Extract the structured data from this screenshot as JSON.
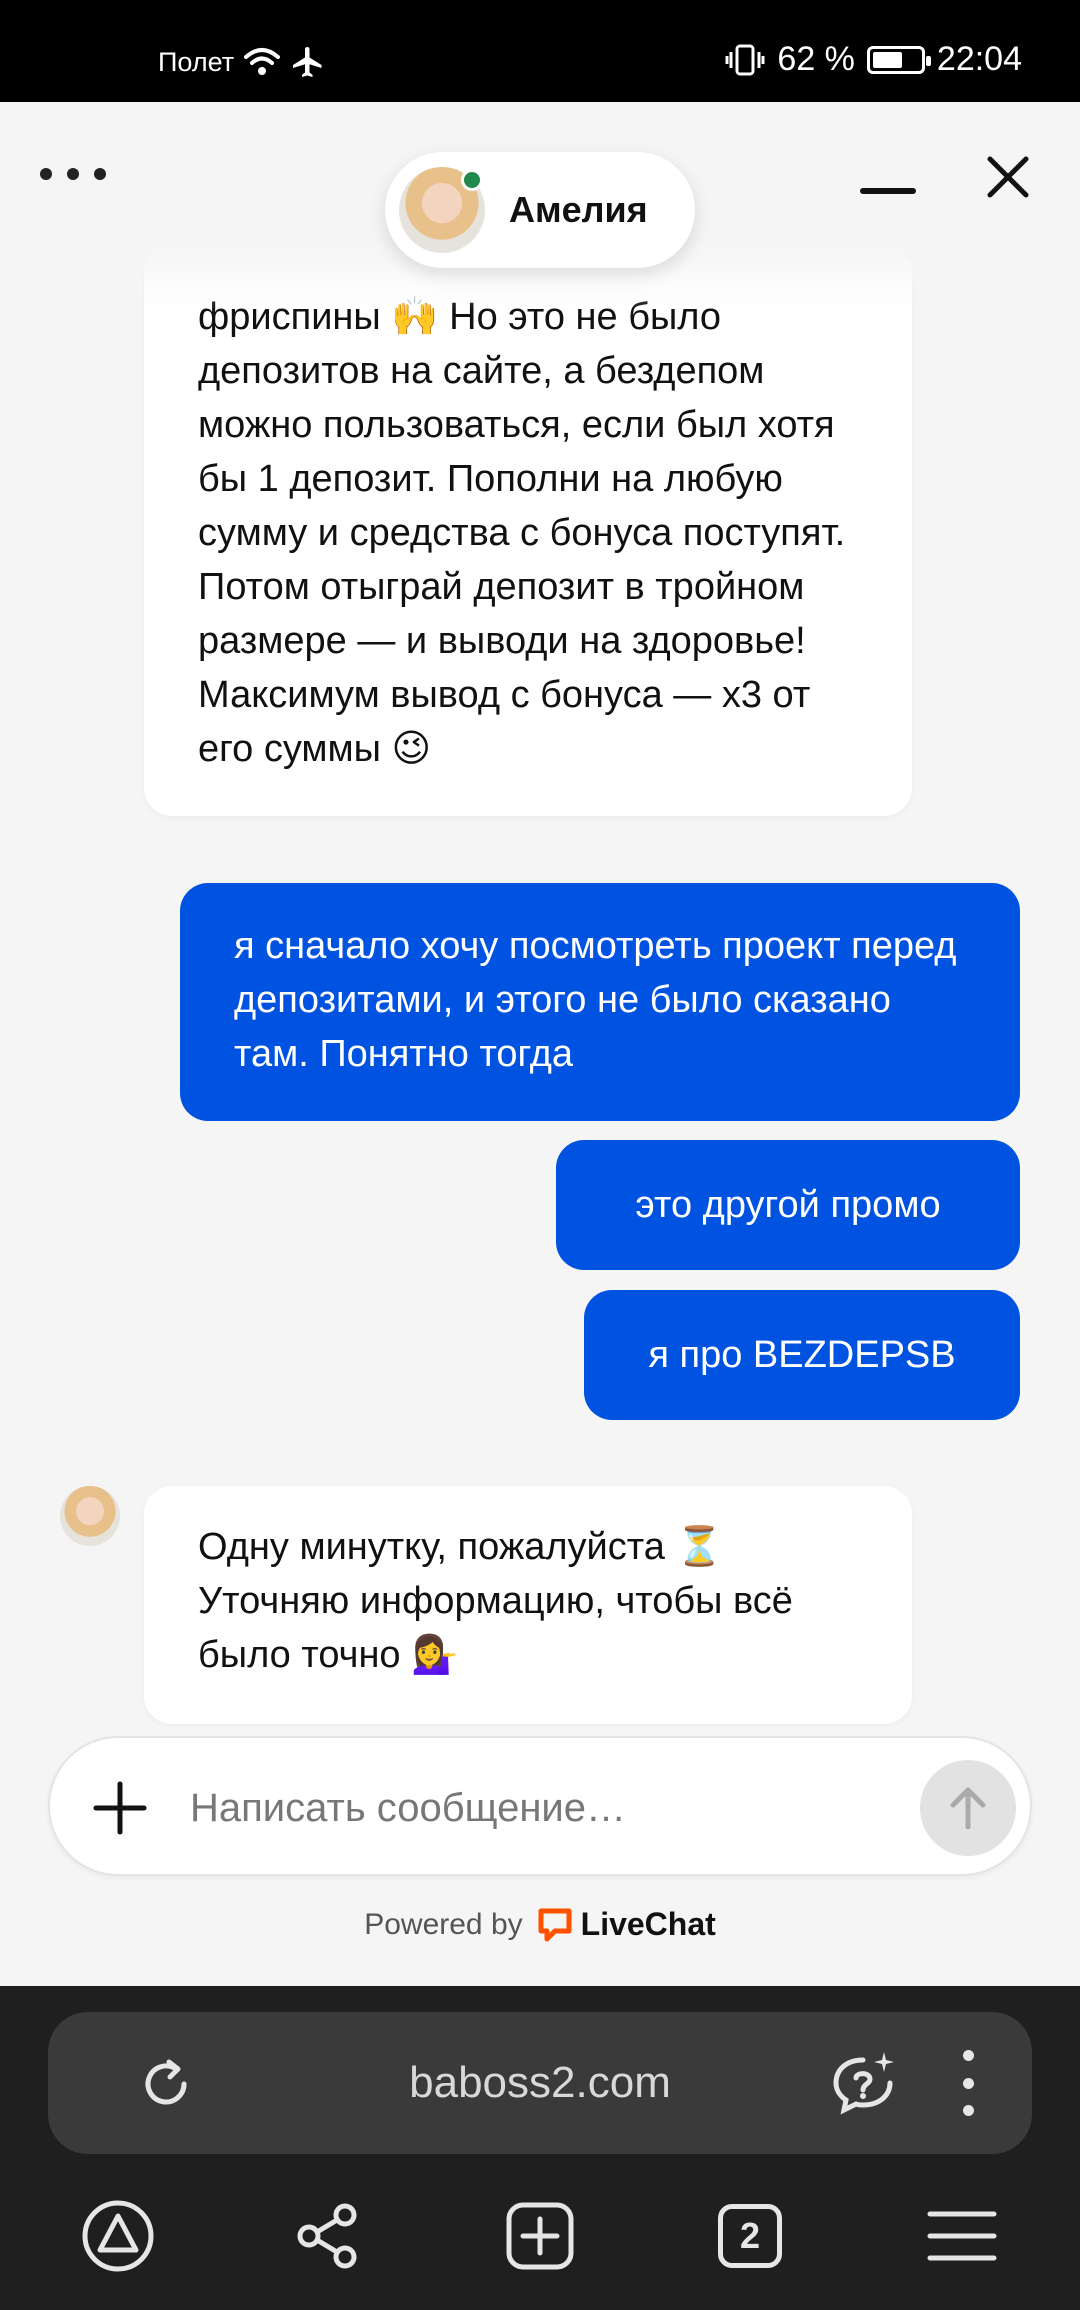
{
  "status_bar": {
    "carrier": "Полет",
    "battery": "62 %",
    "battery_level": 0.62,
    "time": "22:04"
  },
  "chat_header": {
    "agent_name": "Амелия",
    "agent_status": "online"
  },
  "messages": [
    {
      "from": "agent",
      "text": "фриспины 🙌 Но это не было депозитов на сайте, а бездепом можно пользоваться, если был хотя бы 1 депозит. Пополни на любую сумму и средства с бонуса поступят. Потом отыграй депозит в тройном размере — и выводи на здоровье! Максимум вывод с бонуса — x3 от его суммы 😉"
    },
    {
      "from": "user",
      "text": "я сначало хочу посмотреть проект перед депозитами, и этого не было сказано там. Понятно тогда"
    },
    {
      "from": "user",
      "text": "это другой промо"
    },
    {
      "from": "user",
      "text": "я про BEZDEPSB"
    },
    {
      "from": "agent",
      "text": "Одну минутку, пожалуйста ⏳ Уточняю информацию, чтобы всё было точно 💁‍♀️"
    }
  ],
  "composer": {
    "placeholder": "Написать сообщение…"
  },
  "footer": {
    "powered_by": "Powered by",
    "brand": "LiveChat",
    "brand_color": "#ff5100"
  },
  "browser": {
    "url": "baboss2.com",
    "tab_count": "2"
  },
  "colors": {
    "user_bubble": "#0053e0",
    "agent_bubble": "#ffffff",
    "background": "#f5f5f5",
    "online": "#1f8a4c"
  }
}
